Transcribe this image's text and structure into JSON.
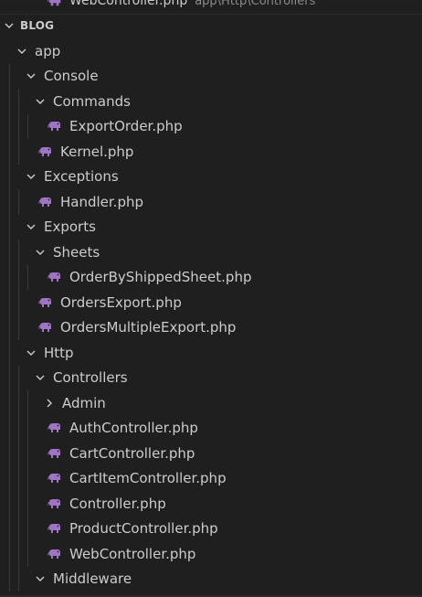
{
  "open_editor": {
    "name": "WebController.php",
    "path": "app\\Http\\Controllers"
  },
  "section": {
    "title": "BLOG"
  },
  "icons": {
    "folder_expanded": "chevron-down-icon",
    "folder_collapsed": "chevron-right-icon",
    "php_file": "php-elephant-icon"
  },
  "colors": {
    "background": "#1f1f1f",
    "text": "#cccccc",
    "php_icon": "#a074c4",
    "muted": "#8b8b8b"
  },
  "tree": [
    {
      "label": "app",
      "type": "folder",
      "expanded": true,
      "depth": 0
    },
    {
      "label": "Console",
      "type": "folder",
      "expanded": true,
      "depth": 1
    },
    {
      "label": "Commands",
      "type": "folder",
      "expanded": true,
      "depth": 2
    },
    {
      "label": "ExportOrder.php",
      "type": "file",
      "depth": 3
    },
    {
      "label": "Kernel.php",
      "type": "file",
      "depth": 2
    },
    {
      "label": "Exceptions",
      "type": "folder",
      "expanded": true,
      "depth": 1
    },
    {
      "label": "Handler.php",
      "type": "file",
      "depth": 2
    },
    {
      "label": "Exports",
      "type": "folder",
      "expanded": true,
      "depth": 1
    },
    {
      "label": "Sheets",
      "type": "folder",
      "expanded": true,
      "depth": 2
    },
    {
      "label": "OrderByShippedSheet.php",
      "type": "file",
      "depth": 3
    },
    {
      "label": "OrdersExport.php",
      "type": "file",
      "depth": 2
    },
    {
      "label": "OrdersMultipleExport.php",
      "type": "file",
      "depth": 2
    },
    {
      "label": "Http",
      "type": "folder",
      "expanded": true,
      "depth": 1
    },
    {
      "label": "Controllers",
      "type": "folder",
      "expanded": true,
      "depth": 2
    },
    {
      "label": "Admin",
      "type": "folder",
      "expanded": false,
      "depth": 3
    },
    {
      "label": "AuthController.php",
      "type": "file",
      "depth": 3
    },
    {
      "label": "CartController.php",
      "type": "file",
      "depth": 3
    },
    {
      "label": "CartItemController.php",
      "type": "file",
      "depth": 3
    },
    {
      "label": "Controller.php",
      "type": "file",
      "depth": 3
    },
    {
      "label": "ProductController.php",
      "type": "file",
      "depth": 3
    },
    {
      "label": "WebController.php",
      "type": "file",
      "depth": 3
    },
    {
      "label": "Middleware",
      "type": "folder",
      "expanded": true,
      "depth": 2
    }
  ]
}
